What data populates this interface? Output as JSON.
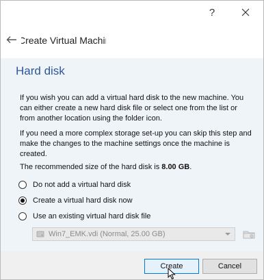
{
  "titlebar": {
    "help_label": "?",
    "close_icon": "close-icon"
  },
  "header": {
    "back_icon": "arrow-left-icon",
    "title": "Create Virtual Machine"
  },
  "section": {
    "title": "Hard disk",
    "paragraph1": "If you wish you can add a virtual hard disk to the new machine. You can either create a new hard disk file or select one from the list or from another location using the folder icon.",
    "paragraph2": "If you need a more complex storage set-up you can skip this step and make the changes to the machine settings once the machine is created.",
    "recommended_prefix": "The recommended size of the hard disk is ",
    "recommended_size": "8.00 GB",
    "recommended_suffix": "."
  },
  "options": {
    "no_disk": "Do not add a virtual hard disk",
    "create_now": "Create a virtual hard disk now",
    "use_existing": "Use an existing virtual hard disk file",
    "selected": "create_now"
  },
  "existing_disk": {
    "value": "Win7_EMK.vdi (Normal, 25.00 GB)",
    "enabled": false,
    "folder_icon": "folder-icon"
  },
  "footer": {
    "create_label": "Create",
    "cancel_label": "Cancel"
  },
  "colors": {
    "section_title": "#2b579a",
    "content_bg": "#eff4f9",
    "default_button_border": "#0078d7"
  }
}
